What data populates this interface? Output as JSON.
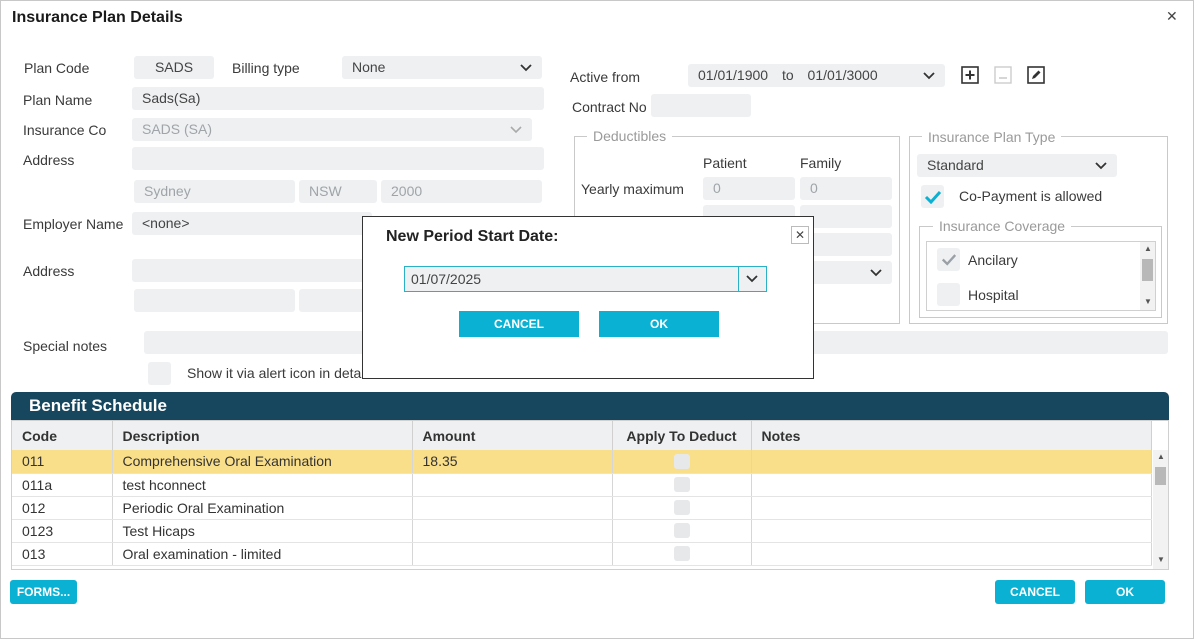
{
  "window": {
    "title": "Insurance Plan Details"
  },
  "plan": {
    "plan_code_label": "Plan Code",
    "plan_code": "SADS",
    "billing_type_label": "Billing type",
    "billing_type": "None",
    "plan_name_label": "Plan Name",
    "plan_name": "Sads(Sa)",
    "insurance_co_label": "Insurance Co",
    "insurance_co": "SADS (SA)",
    "address_label": "Address",
    "address_line": "",
    "city": "Sydney",
    "state": "NSW",
    "postcode": "2000",
    "employer_label": "Employer Name",
    "employer": "<none>",
    "address2_label": "Address",
    "special_notes_label": "Special notes",
    "alert_label": "Show it via alert icon in details"
  },
  "active": {
    "label": "Active from",
    "from": "01/01/1900",
    "to_label": "to",
    "to": "01/01/3000",
    "contract_label": "Contract No",
    "contract": ""
  },
  "deductibles": {
    "legend": "Deductibles",
    "patient_header": "Patient",
    "family_header": "Family",
    "yearly_label": "Yearly maximum",
    "yearly_patient": "0",
    "yearly_family": "0"
  },
  "plan_type": {
    "legend": "Insurance Plan Type",
    "value": "Standard",
    "copay_label": "Co-Payment is allowed",
    "coverage_legend": "Insurance Coverage",
    "coverage_items": [
      {
        "label": "Ancilary",
        "checked": true
      },
      {
        "label": "Hospital",
        "checked": false
      }
    ]
  },
  "benefit": {
    "title": "Benefit Schedule",
    "columns": [
      "Code",
      "Description",
      "Amount",
      "Apply To Deduct",
      "Notes"
    ],
    "rows": [
      {
        "code": "011",
        "description": "Comprehensive Oral Examination",
        "amount": "18.35",
        "notes": ""
      },
      {
        "code": "011a",
        "description": "test hconnect",
        "amount": "",
        "notes": ""
      },
      {
        "code": "012",
        "description": "Periodic Oral Examination",
        "amount": "",
        "notes": ""
      },
      {
        "code": "0123",
        "description": "Test Hicaps",
        "amount": "",
        "notes": ""
      },
      {
        "code": "013",
        "description": "Oral examination - limited",
        "amount": "",
        "notes": ""
      }
    ]
  },
  "footer": {
    "forms": "FORMS...",
    "cancel": "CANCEL",
    "ok": "OK"
  },
  "modal": {
    "title": "New Period Start Date:",
    "date": "01/07/2025",
    "cancel": "CANCEL",
    "ok": "OK"
  },
  "colors": {
    "accent": "#0ab1d3",
    "header_bar": "#17465f",
    "selected_row": "#fadf8a"
  }
}
